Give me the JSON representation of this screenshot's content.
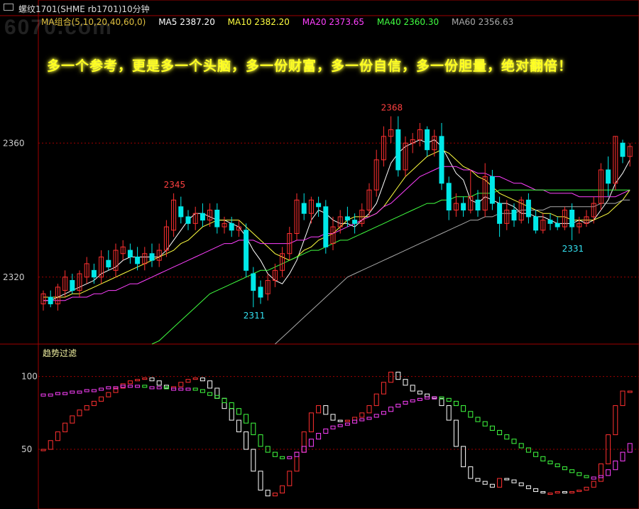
{
  "header": {
    "title": "螺纹1701(SHME rb1701)10分钟",
    "ma_group_label": "MA组合(5,10,20,40,60,0)",
    "ma5": "MA5 2387.20",
    "ma10": "MA10 2382.20",
    "ma20": "MA20 2373.65",
    "ma40": "MA40 2360.30",
    "ma60": "MA60 2356.63"
  },
  "colors": {
    "ma_group": "#e0c040",
    "ma5": "#ffffff",
    "ma10": "#ffff40",
    "ma20": "#ff40ff",
    "ma40": "#40ff40",
    "ma60": "#aaaaaa",
    "up": "#ff3030",
    "down": "#00e8e8",
    "osc_rising": "#ff3030",
    "osc_falling": "#ffffff",
    "osc_signal_up": "#ff40ff",
    "osc_signal_down": "#40ff40"
  },
  "slogan": "多一个参考，更是多一个头脑，多一份财富，多一份自信，多一份胆量，绝对翻倍！",
  "watermark": "6070.com",
  "oscillator_label": "趋势过滤",
  "chart_data": [
    {
      "type": "candlestick",
      "yticks": [
        2320,
        2360
      ],
      "ylim": [
        2300,
        2373
      ],
      "annotations": [
        {
          "text": "2345",
          "bar": 18,
          "kind": "high"
        },
        {
          "text": "2368",
          "bar": 48,
          "kind": "high"
        },
        {
          "text": "2311",
          "bar": 29,
          "kind": "low"
        },
        {
          "text": "2331",
          "bar": 73,
          "kind": "low"
        }
      ],
      "candles": [
        [
          2312,
          2315,
          2310,
          2316
        ],
        [
          2314,
          2312,
          2311,
          2316
        ],
        [
          2312,
          2317,
          2310,
          2318
        ],
        [
          2316,
          2320,
          2314,
          2322
        ],
        [
          2319,
          2316,
          2315,
          2321
        ],
        [
          2316,
          2321,
          2314,
          2322
        ],
        [
          2320,
          2324,
          2318,
          2326
        ],
        [
          2322,
          2320,
          2318,
          2324
        ],
        [
          2320,
          2326,
          2318,
          2328
        ],
        [
          2325,
          2323,
          2322,
          2328
        ],
        [
          2322,
          2328,
          2320,
          2330
        ],
        [
          2327,
          2329,
          2325,
          2331
        ],
        [
          2328,
          2326,
          2324,
          2330
        ],
        [
          2326,
          2324,
          2322,
          2329
        ],
        [
          2324,
          2327,
          2322,
          2329
        ],
        [
          2327,
          2325,
          2323,
          2330
        ],
        [
          2325,
          2328,
          2323,
          2330
        ],
        [
          2328,
          2335,
          2326,
          2337
        ],
        [
          2334,
          2343,
          2332,
          2345
        ],
        [
          2341,
          2338,
          2336,
          2344
        ],
        [
          2338,
          2336,
          2334,
          2340
        ],
        [
          2336,
          2339,
          2334,
          2341
        ],
        [
          2339,
          2337,
          2335,
          2342
        ],
        [
          2337,
          2340,
          2335,
          2342
        ],
        [
          2340,
          2335,
          2333,
          2342
        ],
        [
          2335,
          2336,
          2333,
          2338
        ],
        [
          2336,
          2334,
          2332,
          2338
        ],
        [
          2334,
          2335,
          2332,
          2337
        ],
        [
          2334,
          2322,
          2320,
          2336
        ],
        [
          2321,
          2316,
          2311,
          2323
        ],
        [
          2317,
          2314,
          2312,
          2319
        ],
        [
          2315,
          2319,
          2313,
          2321
        ],
        [
          2319,
          2322,
          2317,
          2324
        ],
        [
          2322,
          2327,
          2320,
          2329
        ],
        [
          2327,
          2333,
          2325,
          2335
        ],
        [
          2333,
          2343,
          2331,
          2345
        ],
        [
          2342,
          2339,
          2337,
          2345
        ],
        [
          2339,
          2343,
          2336,
          2344
        ],
        [
          2342,
          2341,
          2338,
          2344
        ],
        [
          2341,
          2329,
          2327,
          2343
        ],
        [
          2330,
          2335,
          2328,
          2338
        ],
        [
          2335,
          2338,
          2333,
          2340
        ],
        [
          2338,
          2337,
          2335,
          2341
        ],
        [
          2337,
          2336,
          2333,
          2339
        ],
        [
          2336,
          2340,
          2335,
          2342
        ],
        [
          2340,
          2346,
          2338,
          2348
        ],
        [
          2346,
          2355,
          2344,
          2358
        ],
        [
          2355,
          2362,
          2353,
          2365
        ],
        [
          2362,
          2364,
          2360,
          2368
        ],
        [
          2364,
          2352,
          2350,
          2368
        ],
        [
          2352,
          2360,
          2350,
          2362
        ],
        [
          2360,
          2361,
          2357,
          2363
        ],
        [
          2361,
          2364,
          2359,
          2366
        ],
        [
          2364,
          2358,
          2356,
          2365
        ],
        [
          2358,
          2362,
          2356,
          2364
        ],
        [
          2362,
          2348,
          2346,
          2366
        ],
        [
          2348,
          2340,
          2337,
          2350
        ],
        [
          2340,
          2342,
          2338,
          2345
        ],
        [
          2342,
          2340,
          2338,
          2344
        ],
        [
          2340,
          2344,
          2339,
          2352
        ],
        [
          2343,
          2340,
          2338,
          2346
        ],
        [
          2340,
          2350,
          2338,
          2354
        ],
        [
          2350,
          2342,
          2340,
          2352
        ],
        [
          2342,
          2336,
          2332,
          2344
        ],
        [
          2336,
          2340,
          2334,
          2343
        ],
        [
          2340,
          2337,
          2335,
          2342
        ],
        [
          2337,
          2343,
          2336,
          2344
        ],
        [
          2343,
          2338,
          2336,
          2345
        ],
        [
          2338,
          2334,
          2333,
          2340
        ],
        [
          2334,
          2337,
          2333,
          2339
        ],
        [
          2337,
          2336,
          2334,
          2339
        ],
        [
          2336,
          2335,
          2334,
          2338
        ],
        [
          2335,
          2340,
          2334,
          2341
        ],
        [
          2340,
          2335,
          2331,
          2342
        ],
        [
          2335,
          2336,
          2333,
          2338
        ],
        [
          2336,
          2338,
          2335,
          2340
        ],
        [
          2338,
          2342,
          2336,
          2344
        ],
        [
          2342,
          2352,
          2340,
          2354
        ],
        [
          2352,
          2348,
          2344,
          2356
        ],
        [
          2348,
          2362,
          2346,
          2362
        ],
        [
          2360,
          2356,
          2354,
          2361
        ],
        [
          2356,
          2359,
          2353,
          2360
        ]
      ],
      "ma_series": [
        {
          "name": "MA5",
          "values": [
            2313,
            2313,
            2314,
            2315,
            2316,
            2317,
            2318,
            2319,
            2321,
            2322,
            2323,
            2325,
            2326,
            2326,
            2326,
            2326,
            2326,
            2328,
            2331,
            2334,
            2337,
            2339,
            2339,
            2338,
            2337,
            2337,
            2336,
            2335,
            2332,
            2328,
            2325,
            2321,
            2319,
            2318,
            2321,
            2325,
            2331,
            2337,
            2340,
            2339,
            2337,
            2336,
            2336,
            2335,
            2337,
            2339,
            2342,
            2348,
            2354,
            2357,
            2359,
            2360,
            2361,
            2360,
            2361,
            2359,
            2355,
            2351,
            2349,
            2343,
            2342,
            2344,
            2343,
            2342,
            2342,
            2341,
            2339,
            2339,
            2338,
            2338,
            2337,
            2336,
            2336,
            2336,
            2337,
            2336,
            2337,
            2340,
            2343,
            2348,
            2351,
            2355
          ]
        },
        {
          "name": "MA10",
          "values": [
            2314,
            2314,
            2314,
            2314,
            2315,
            2315,
            2316,
            2317,
            2318,
            2319,
            2320,
            2321,
            2322,
            2323,
            2324,
            2325,
            2326,
            2327,
            2328,
            2330,
            2331,
            2333,
            2335,
            2336,
            2337,
            2337,
            2337,
            2337,
            2335,
            2333,
            2331,
            2329,
            2327,
            2326,
            2325,
            2326,
            2328,
            2329,
            2331,
            2332,
            2333,
            2335,
            2337,
            2338,
            2338,
            2338,
            2339,
            2341,
            2344,
            2347,
            2350,
            2352,
            2354,
            2356,
            2357,
            2358,
            2357,
            2355,
            2353,
            2352,
            2350,
            2349,
            2347,
            2345,
            2344,
            2343,
            2342,
            2341,
            2340,
            2339,
            2339,
            2338,
            2338,
            2337,
            2337,
            2337,
            2337,
            2338,
            2339,
            2341,
            2343,
            2346
          ]
        },
        {
          "name": "MA20",
          "values": [
            2313,
            2313,
            2313,
            2313,
            2314,
            2314,
            2314,
            2315,
            2315,
            2316,
            2316,
            2317,
            2318,
            2318,
            2319,
            2320,
            2321,
            2322,
            2323,
            2324,
            2325,
            2326,
            2327,
            2328,
            2329,
            2330,
            2330,
            2331,
            2331,
            2331,
            2330,
            2330,
            2330,
            2330,
            2330,
            2331,
            2331,
            2332,
            2332,
            2333,
            2333,
            2334,
            2335,
            2336,
            2337,
            2338,
            2339,
            2341,
            2342,
            2344,
            2346,
            2348,
            2350,
            2351,
            2352,
            2353,
            2353,
            2353,
            2352,
            2352,
            2351,
            2351,
            2350,
            2350,
            2349,
            2348,
            2348,
            2347,
            2346,
            2346,
            2345,
            2345,
            2345,
            2345,
            2344,
            2344,
            2344,
            2344,
            2344,
            2344,
            2345,
            2346
          ]
        },
        {
          "name": "MA40",
          "values": [
            null,
            null,
            null,
            null,
            null,
            null,
            null,
            null,
            null,
            null,
            null,
            null,
            null,
            null,
            null,
            2300,
            2301,
            2303,
            2305,
            2307,
            2309,
            2311,
            2313,
            2315,
            2316,
            2317,
            2318,
            2319,
            2320,
            2321,
            2322,
            2322,
            2323,
            2324,
            2325,
            2326,
            2327,
            2328,
            2328,
            2329,
            2330,
            2331,
            2331,
            2332,
            2333,
            2334,
            2335,
            2336,
            2337,
            2338,
            2339,
            2340,
            2341,
            2342,
            2342,
            2343,
            2343,
            2344,
            2344,
            2344,
            2345,
            2345,
            2345,
            2346,
            2346,
            2346,
            2346,
            2346,
            2346,
            2346,
            2346,
            2346,
            2346,
            2346,
            2346,
            2346,
            2346,
            2346,
            2346,
            2346,
            2346,
            2346
          ]
        },
        {
          "name": "MA60",
          "values": [
            null,
            null,
            null,
            null,
            null,
            null,
            null,
            null,
            null,
            null,
            null,
            null,
            null,
            null,
            null,
            null,
            null,
            null,
            null,
            null,
            null,
            null,
            null,
            null,
            null,
            null,
            null,
            null,
            null,
            null,
            null,
            null,
            2300,
            2302,
            2304,
            2306,
            2308,
            2310,
            2312,
            2314,
            2316,
            2318,
            2320,
            2321,
            2322,
            2323,
            2324,
            2325,
            2326,
            2327,
            2328,
            2329,
            2330,
            2331,
            2332,
            2333,
            2334,
            2335,
            2336,
            2337,
            2337,
            2338,
            2338,
            2339,
            2339,
            2339,
            2340,
            2340,
            2340,
            2340,
            2341,
            2341,
            2341,
            2341,
            2341,
            2341,
            2341,
            2342,
            2342,
            2342,
            2343,
            2343
          ]
        }
      ]
    },
    {
      "type": "bar",
      "title": "趋势过滤",
      "yticks": [
        50,
        100
      ],
      "ylim": [
        10,
        112
      ],
      "fast": [
        50,
        56,
        62,
        68,
        73,
        77,
        80,
        83,
        86,
        89,
        92,
        95,
        97,
        98,
        99,
        97,
        94,
        92,
        93,
        96,
        98,
        99,
        97,
        92,
        85,
        78,
        70,
        62,
        50,
        35,
        22,
        18,
        20,
        25,
        35,
        48,
        62,
        75,
        80,
        74,
        70,
        69,
        70,
        72,
        75,
        80,
        88,
        96,
        103,
        98,
        94,
        90,
        88,
        86,
        85,
        80,
        70,
        52,
        38,
        30,
        28,
        26,
        24,
        30,
        29,
        27,
        25,
        23,
        21,
        20,
        20,
        21,
        20,
        21,
        22,
        24,
        28,
        40,
        60,
        80,
        90,
        90
      ],
      "signal": [
        88,
        88,
        89,
        89,
        90,
        90,
        91,
        91,
        92,
        93,
        93,
        94,
        94,
        94,
        93,
        93,
        93,
        92,
        92,
        92,
        92,
        91,
        89,
        87,
        85,
        82,
        78,
        74,
        68,
        60,
        52,
        48,
        45,
        44,
        45,
        48,
        52,
        57,
        61,
        64,
        66,
        67,
        68,
        70,
        71,
        72,
        74,
        76,
        79,
        81,
        83,
        84,
        85,
        86,
        86,
        85,
        83,
        80,
        76,
        72,
        69,
        66,
        63,
        60,
        57,
        54,
        51,
        48,
        45,
        42,
        40,
        38,
        36,
        34,
        32,
        31,
        31,
        32,
        36,
        42,
        48,
        54
      ]
    }
  ]
}
